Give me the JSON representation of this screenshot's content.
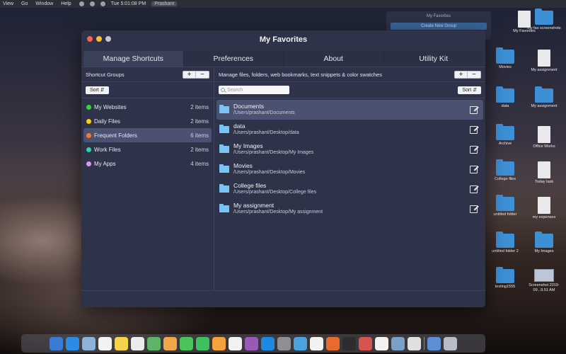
{
  "menubar": {
    "items": [
      "View",
      "Go",
      "Window",
      "Help"
    ],
    "clock": "Tue 5:01:08 PM",
    "user": "Prashant"
  },
  "background_window": {
    "title": "My Favorites",
    "button": "Create New Group"
  },
  "desktop_icons": [
    {
      "label": "My Favorites",
      "kind": "doc"
    },
    {
      "label": "my fav screenshots",
      "kind": "folder"
    },
    {
      "label": "Movies",
      "kind": "folder"
    },
    {
      "label": "My assignment",
      "kind": "doc"
    },
    {
      "label": "data",
      "kind": "folder"
    },
    {
      "label": "My assignment",
      "kind": "folder"
    },
    {
      "label": "Archive",
      "kind": "folder"
    },
    {
      "label": "Office Works",
      "kind": "doc"
    },
    {
      "label": "College files",
      "kind": "folder"
    },
    {
      "label": "Today task",
      "kind": "doc"
    },
    {
      "label": "untitled folder",
      "kind": "folder"
    },
    {
      "label": "my expenses",
      "kind": "doc"
    },
    {
      "label": "untitled folder 2",
      "kind": "folder"
    },
    {
      "label": "My Images",
      "kind": "folder"
    },
    {
      "label": "testing1555",
      "kind": "folder"
    },
    {
      "label": "Screenshot 2019-09...9.51 AM",
      "kind": "shot"
    }
  ],
  "window": {
    "title": "My Favorites",
    "tabs": [
      "Manage Shortcuts",
      "Preferences",
      "About",
      "Utility Kit"
    ],
    "active_tab": 0
  },
  "left_pane": {
    "header": "Shortcut Groups",
    "add": "+",
    "remove": "−",
    "sort_label": "Sort ⇵",
    "groups": [
      {
        "name": "My Websites",
        "count": "2 items",
        "color": "#3bd13b"
      },
      {
        "name": "Daily Files",
        "count": "2 items",
        "color": "#f2d21f"
      },
      {
        "name": "Frequent Folders",
        "count": "6 items",
        "color": "#f07a38"
      },
      {
        "name": "Work Files",
        "count": "2 items",
        "color": "#2fd3a8"
      },
      {
        "name": "My Apps",
        "count": "4 items",
        "color": "#d99ae6"
      }
    ],
    "selected_index": 2
  },
  "right_pane": {
    "header": "Manage files, folders, web bookmarks, text snippets & color swatches",
    "add": "+",
    "remove": "−",
    "search_placeholder": "Search",
    "sort_label": "Sort ⇵",
    "items": [
      {
        "title": "Documents",
        "path": "/Users/prashant/Documents"
      },
      {
        "title": "data",
        "path": "/Users/prashant/Desktop/data"
      },
      {
        "title": "My Images",
        "path": "/Users/prashant/Desktop/My Images"
      },
      {
        "title": "Movies",
        "path": "/Users/prashant/Desktop/Movies"
      },
      {
        "title": "College files",
        "path": "/Users/prashant/Desktop/College files"
      },
      {
        "title": "My assignment",
        "path": "/Users/prashant/Desktop/My assignment"
      }
    ],
    "selected_index": 0
  },
  "dock": {
    "apps": [
      "finder-icon",
      "safari-icon",
      "mail-icon",
      "calendar-icon",
      "notes-icon",
      "reminders-icon",
      "maps-icon",
      "photos-icon",
      "messages-icon",
      "facetime-icon",
      "pages-icon",
      "music-icon",
      "podcasts-icon",
      "appstore-icon",
      "preferences-icon",
      "xcode-icon",
      "chrome-icon",
      "firefox-icon",
      "terminal-icon",
      "tools-icon",
      "textedit-icon",
      "preview-icon",
      "notes2-icon",
      "downloads-icon",
      "trash-icon"
    ]
  }
}
